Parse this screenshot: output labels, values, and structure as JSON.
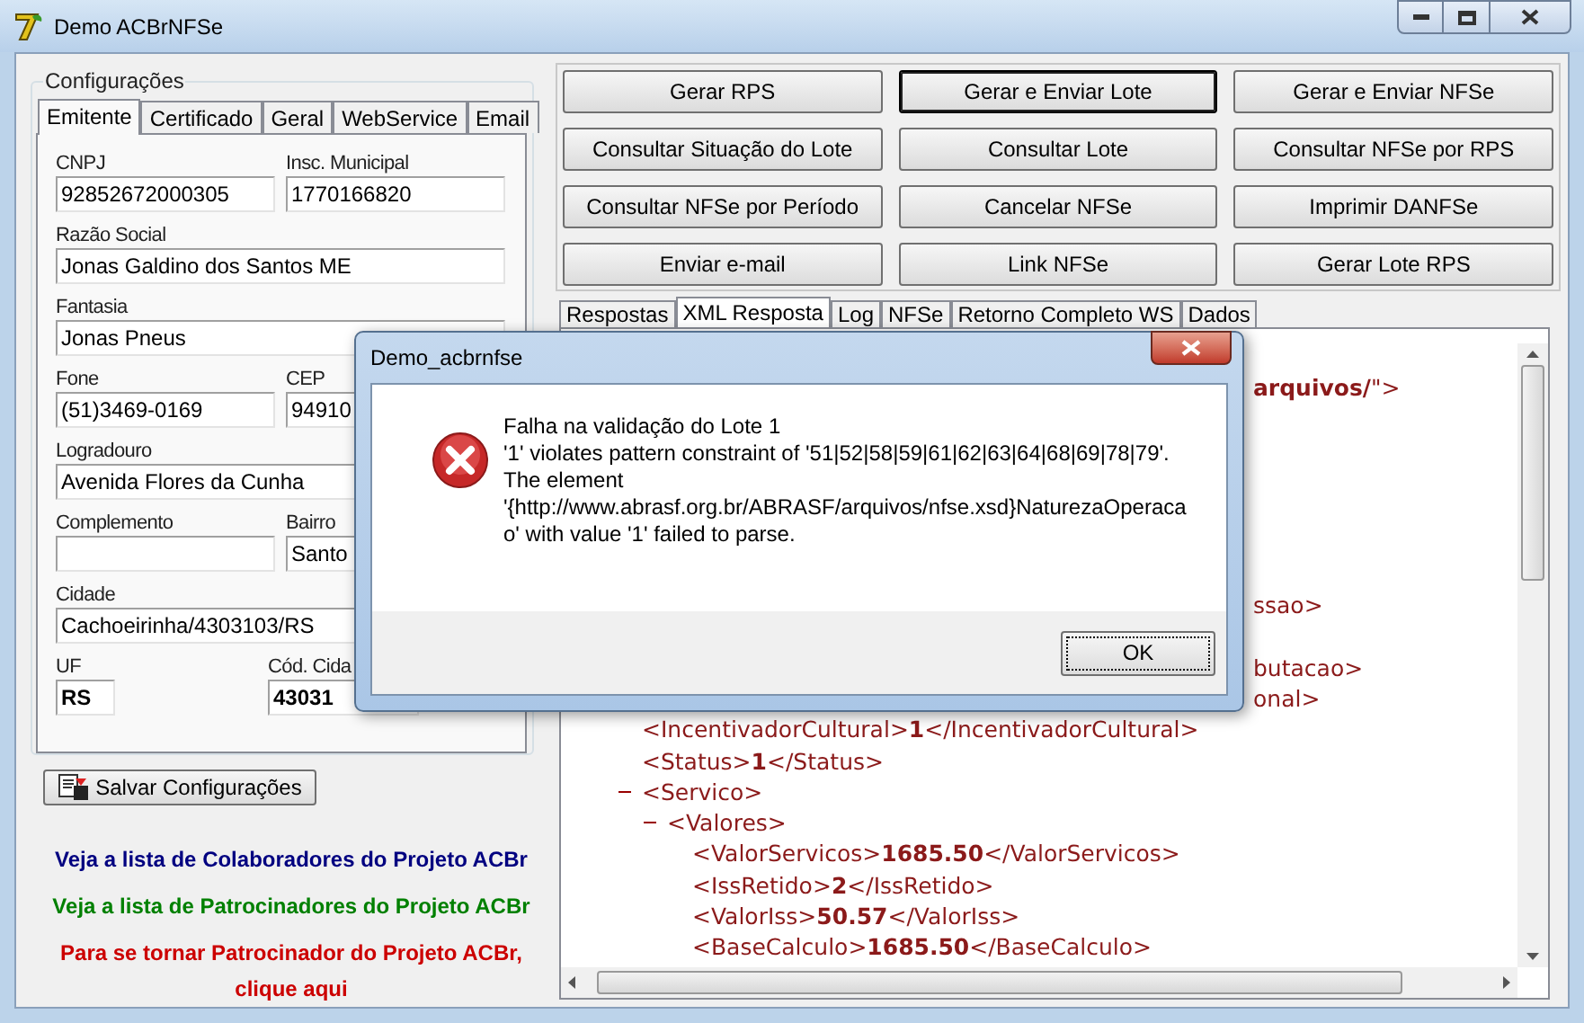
{
  "window": {
    "title": "Demo ACBrNFSe"
  },
  "config": {
    "title": "Configurações",
    "tabs": [
      {
        "label": "Emitente",
        "selected": true
      },
      {
        "label": "Certificado",
        "selected": false
      },
      {
        "label": "Geral",
        "selected": false
      },
      {
        "label": "WebService",
        "selected": false
      },
      {
        "label": "Email",
        "selected": false
      }
    ],
    "rows": [
      [
        {
          "label": "CNPJ",
          "value": "92852672000305",
          "kind": "half"
        },
        {
          "label": "Insc. Municipal",
          "value": "1770166820",
          "kind": "half"
        }
      ],
      [
        {
          "label": "Razão Social",
          "value": "Jonas Galdino dos Santos ME",
          "kind": "full"
        }
      ],
      [
        {
          "label": "Fantasia",
          "value": "Jonas Pneus",
          "kind": "full"
        }
      ],
      [
        {
          "label": "Fone",
          "value": "(51)3469-0169",
          "kind": "half"
        },
        {
          "label": "CEP",
          "value": "94910",
          "kind": "half"
        }
      ],
      [
        {
          "label": "Logradouro",
          "value": "Avenida Flores da Cunha",
          "kind": "full"
        }
      ],
      [
        {
          "label": "Complemento",
          "kind": "half"
        },
        {
          "label": "Bairro",
          "value": "Santo",
          "kind": "half"
        }
      ],
      [
        {
          "label": "Cidade",
          "value": "Cachoeirinha/4303103/RS",
          "kind": "full"
        }
      ],
      [
        {
          "label": "UF",
          "value": "RS",
          "kind": "small"
        },
        {
          "label": "Cód. Cida",
          "value": "43031",
          "kind": "code"
        }
      ]
    ]
  },
  "save_button": "Salvar Configurações",
  "links": [
    {
      "text": "Veja a lista de Colaboradores do Projeto ACBr",
      "color": "#000080"
    },
    {
      "text": "Veja a lista de Patrocinadores do Projeto ACBr",
      "color": "#008000"
    },
    {
      "text": "Para se tornar Patrocinador do Projeto ACBr, clique aqui",
      "color": "#cc0000"
    }
  ],
  "actions": [
    {
      "label": "Gerar RPS",
      "focused": false
    },
    {
      "label": "Gerar e Enviar Lote",
      "focused": true
    },
    {
      "label": "Gerar e Enviar NFSe",
      "focused": false
    },
    {
      "label": "Consultar Situação do Lote",
      "focused": false
    },
    {
      "label": "Consultar Lote",
      "focused": false
    },
    {
      "label": "Consultar NFSe por RPS",
      "focused": false
    },
    {
      "label": "Consultar NFSe por Período",
      "focused": false
    },
    {
      "label": "Cancelar NFSe",
      "focused": false
    },
    {
      "label": "Imprimir DANFSe",
      "focused": false
    },
    {
      "label": "Enviar e-mail",
      "focused": false
    },
    {
      "label": "Link NFSe",
      "focused": false
    },
    {
      "label": "Gerar Lote RPS",
      "focused": false
    }
  ],
  "result_tabs": [
    {
      "label": "Respostas",
      "selected": false
    },
    {
      "label": "XML Resposta",
      "selected": true
    },
    {
      "label": "Log",
      "selected": false
    },
    {
      "label": "NFSe",
      "selected": false
    },
    {
      "label": "Retorno Completo WS",
      "selected": false
    },
    {
      "label": "Dados",
      "selected": false
    }
  ],
  "xml": {
    "fragments": [
      "**arquivos/**\">",
      "ssao>",
      "butacao>",
      "onal>"
    ],
    "nodes": [
      {
        "text": "<IncentivadorCultural>**1**</IncentivadorCultural>"
      },
      {
        "text": "<Status>**1**</Status>"
      },
      {
        "text": "<Servico>",
        "expanded": true,
        "children": [
          {
            "text": "<Valores>",
            "expanded": true,
            "children": [
              {
                "text": "<ValorServicos>**1685.50**</ValorServicos>"
              },
              {
                "text": "<IssRetido>**2**</IssRetido>"
              },
              {
                "text": "<ValorIss>**50.57**</ValorIss>"
              },
              {
                "text": "<BaseCalculo>**1685.50**</BaseCalculo>"
              }
            ]
          }
        ]
      }
    ]
  },
  "dialog": {
    "title": "Demo_acbrnfse",
    "message_lines": [
      "Falha na validação do Lote 1",
      "'1' violates pattern constraint of '51|52|58|59|61|62|63|64|68|69|78|79'.",
      "The element",
      "'{http://www.abrasf.org.br/ABRASF/arquivos/nfse.xsd}NaturezaOperaca",
      "o' with value '1' failed to parse."
    ],
    "button": "OK"
  }
}
